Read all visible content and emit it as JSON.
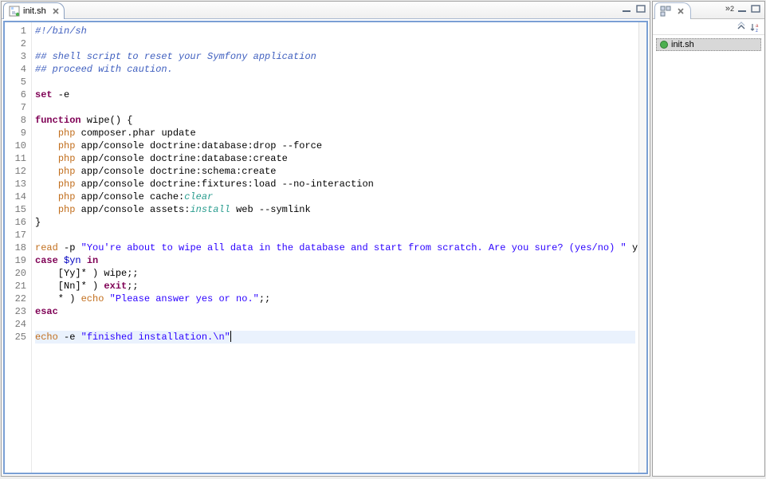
{
  "editor": {
    "tab_label": "init.sh",
    "lines": [
      {
        "n": 1,
        "seg": [
          {
            "c": "cmt",
            "t": "#!/bin/sh"
          }
        ]
      },
      {
        "n": 2,
        "seg": []
      },
      {
        "n": 3,
        "seg": [
          {
            "c": "cmt",
            "t": "## shell script to reset your Symfony application"
          }
        ]
      },
      {
        "n": 4,
        "seg": [
          {
            "c": "cmt",
            "t": "## proceed with caution."
          }
        ]
      },
      {
        "n": 5,
        "seg": []
      },
      {
        "n": 6,
        "seg": [
          {
            "c": "kw",
            "t": "set"
          },
          {
            "c": "op",
            "t": " -e"
          }
        ]
      },
      {
        "n": 7,
        "seg": []
      },
      {
        "n": 8,
        "seg": [
          {
            "c": "kw",
            "t": "function"
          },
          {
            "c": "op",
            "t": " wipe() {"
          }
        ]
      },
      {
        "n": 9,
        "seg": [
          {
            "c": "op",
            "t": "    "
          },
          {
            "c": "cmd",
            "t": "php"
          },
          {
            "c": "op",
            "t": " composer.phar update"
          }
        ]
      },
      {
        "n": 10,
        "seg": [
          {
            "c": "op",
            "t": "    "
          },
          {
            "c": "cmd",
            "t": "php"
          },
          {
            "c": "op",
            "t": " app/console doctrine:database:drop --force"
          }
        ]
      },
      {
        "n": 11,
        "seg": [
          {
            "c": "op",
            "t": "    "
          },
          {
            "c": "cmd",
            "t": "php"
          },
          {
            "c": "op",
            "t": " app/console doctrine:database:create"
          }
        ]
      },
      {
        "n": 12,
        "seg": [
          {
            "c": "op",
            "t": "    "
          },
          {
            "c": "cmd",
            "t": "php"
          },
          {
            "c": "op",
            "t": " app/console doctrine:schema:create"
          }
        ]
      },
      {
        "n": 13,
        "seg": [
          {
            "c": "op",
            "t": "    "
          },
          {
            "c": "cmd",
            "t": "php"
          },
          {
            "c": "op",
            "t": " app/console doctrine:fixtures:load --no-interaction"
          }
        ]
      },
      {
        "n": 14,
        "seg": [
          {
            "c": "op",
            "t": "    "
          },
          {
            "c": "cmd",
            "t": "php"
          },
          {
            "c": "op",
            "t": " app/console cache:"
          },
          {
            "c": "bi",
            "t": "clear"
          }
        ]
      },
      {
        "n": 15,
        "seg": [
          {
            "c": "op",
            "t": "    "
          },
          {
            "c": "cmd",
            "t": "php"
          },
          {
            "c": "op",
            "t": " app/console assets:"
          },
          {
            "c": "bi",
            "t": "install"
          },
          {
            "c": "op",
            "t": " web --symlink"
          }
        ]
      },
      {
        "n": 16,
        "seg": [
          {
            "c": "op",
            "t": "}"
          }
        ]
      },
      {
        "n": 17,
        "seg": []
      },
      {
        "n": 18,
        "seg": [
          {
            "c": "cmd",
            "t": "read"
          },
          {
            "c": "op",
            "t": " -p "
          },
          {
            "c": "str",
            "t": "\"You're about to wipe all data in the database and start from scratch. Are you sure? (yes/no) \""
          },
          {
            "c": "op",
            "t": " yn"
          }
        ]
      },
      {
        "n": 19,
        "seg": [
          {
            "c": "kw",
            "t": "case"
          },
          {
            "c": "op",
            "t": " "
          },
          {
            "c": "var",
            "t": "$yn"
          },
          {
            "c": "op",
            "t": " "
          },
          {
            "c": "kw",
            "t": "in"
          }
        ]
      },
      {
        "n": 20,
        "seg": [
          {
            "c": "op",
            "t": "    [Yy]* ) wipe;;"
          }
        ]
      },
      {
        "n": 21,
        "seg": [
          {
            "c": "op",
            "t": "    [Nn]* ) "
          },
          {
            "c": "kw",
            "t": "exit"
          },
          {
            "c": "op",
            "t": ";;"
          }
        ]
      },
      {
        "n": 22,
        "seg": [
          {
            "c": "op",
            "t": "    * ) "
          },
          {
            "c": "cmd",
            "t": "echo"
          },
          {
            "c": "op",
            "t": " "
          },
          {
            "c": "str",
            "t": "\"Please answer yes or no.\""
          },
          {
            "c": "op",
            "t": ";;"
          }
        ]
      },
      {
        "n": 23,
        "seg": [
          {
            "c": "kw",
            "t": "esac"
          }
        ]
      },
      {
        "n": 24,
        "seg": []
      },
      {
        "n": 25,
        "current": true,
        "cursor": true,
        "seg": [
          {
            "c": "cmd",
            "t": "echo"
          },
          {
            "c": "op",
            "t": " -e "
          },
          {
            "c": "str",
            "t": "\"finished installation.\\n\""
          }
        ]
      }
    ]
  },
  "outline": {
    "overflow_count": "2",
    "item_label": "init.sh"
  }
}
